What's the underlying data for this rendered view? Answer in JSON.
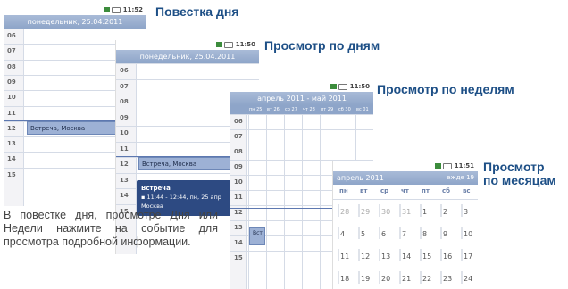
{
  "captions": {
    "agenda": "Повестка дня",
    "day": "Просмотр по дням",
    "week": "Просмотр по неделям",
    "month_line1": "Просмотр",
    "month_line2": "по месяцам"
  },
  "agenda_screen": {
    "status_time": "11:52",
    "header": "понедельник, 25.04.2011",
    "hours": [
      "06",
      "07",
      "08",
      "09",
      "10",
      "11",
      "12",
      "13",
      "14",
      "15"
    ],
    "event": "Встреча, Москва"
  },
  "day_screen": {
    "status_time": "11:50",
    "header": "понедельник, 25.04.2011",
    "hours": [
      "06",
      "07",
      "08",
      "09",
      "10",
      "11",
      "12",
      "13",
      "14",
      "15"
    ],
    "event": "Встреча, Москва",
    "popup": {
      "title": "Встреча",
      "time": "11:44 - 12:44, пн, 25 апр",
      "location": "Москва"
    }
  },
  "week_screen": {
    "status_time": "11:50",
    "header": "апрель 2011 - май 2011",
    "weekdays": [
      "пн 25",
      "вт 26",
      "ср 27",
      "чт 28",
      "пт 29",
      "сб 30",
      "вс 01"
    ],
    "hours": [
      "06",
      "07",
      "08",
      "09",
      "10",
      "11",
      "12",
      "13",
      "14",
      "15"
    ],
    "event": "Вст"
  },
  "month_screen": {
    "status_time": "11:51",
    "header": "апрель 2011",
    "header_right": "ежде 19",
    "weekdays": [
      "пн",
      "вт",
      "ср",
      "чт",
      "пт",
      "сб",
      "вс"
    ],
    "weeks": [
      [
        "28",
        "29",
        "30",
        "31",
        "1",
        "2",
        "3"
      ],
      [
        "4",
        "5",
        "6",
        "7",
        "8",
        "9",
        "10"
      ],
      [
        "11",
        "12",
        "13",
        "14",
        "15",
        "16",
        "17"
      ],
      [
        "18",
        "19",
        "20",
        "21",
        "22",
        "23",
        "24"
      ]
    ]
  },
  "description": "В повестке дня, просмотре Дня или Недели нажмите на событие для просмотра подробной информации."
}
